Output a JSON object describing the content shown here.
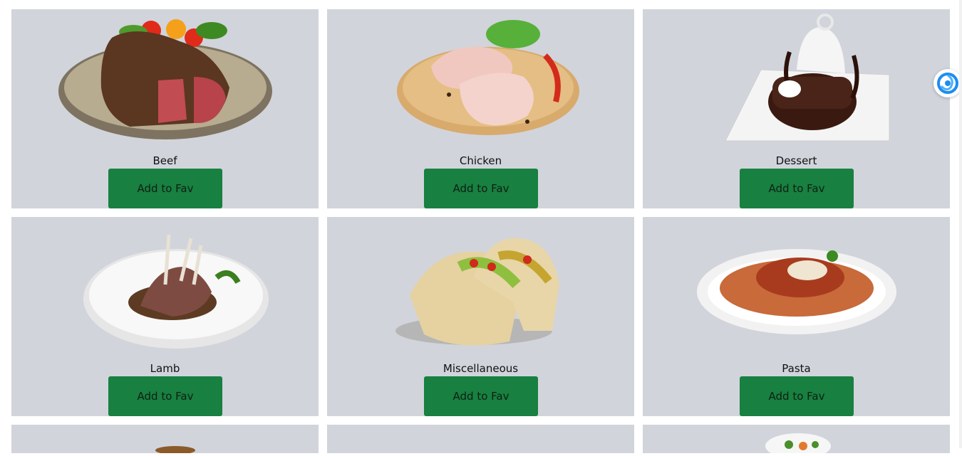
{
  "cards": [
    {
      "name": "Beef",
      "button_label": "Add to Fav"
    },
    {
      "name": "Chicken",
      "button_label": "Add to Fav"
    },
    {
      "name": "Dessert",
      "button_label": "Add to Fav"
    },
    {
      "name": "Lamb",
      "button_label": "Add to Fav"
    },
    {
      "name": "Miscellaneous",
      "button_label": "Add to Fav"
    },
    {
      "name": "Pasta",
      "button_label": "Add to Fav"
    }
  ],
  "extension": {
    "icon": "swirl-extension-icon"
  },
  "colors": {
    "card_bg": "#d1d4db",
    "button_bg": "#188040"
  }
}
